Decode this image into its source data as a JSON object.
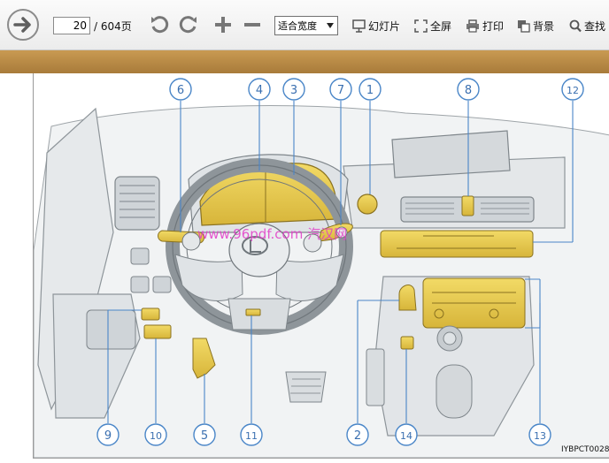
{
  "toolbar": {
    "page_current": "20",
    "page_total": "/ 604页",
    "zoom_value": "适合宽度",
    "slideshow_label": "幻灯片",
    "fullscreen_label": "全屏",
    "print_label": "打印",
    "background_label": "背景",
    "find_label": "查找"
  },
  "figure": {
    "callouts": [
      "1",
      "2",
      "3",
      "4",
      "5",
      "6",
      "7",
      "8",
      "9",
      "10",
      "11",
      "12",
      "13",
      "14"
    ],
    "figure_code": "IYBPCT0028",
    "watermark": "www.96pdf.com 汽汉网"
  },
  "colors": {
    "toolbar_bg": "#efefef",
    "strip": "#b78a45",
    "highlight": "#e6c84a",
    "callout_blue": "#4a86c8"
  }
}
